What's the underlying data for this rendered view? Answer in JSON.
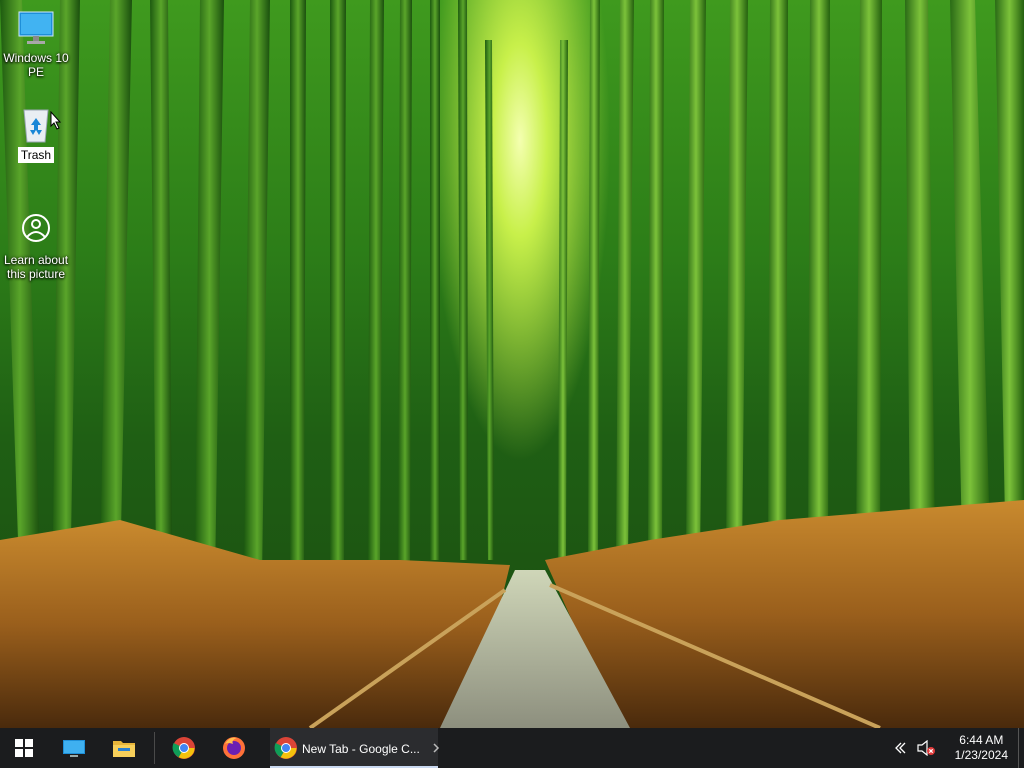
{
  "desktop": {
    "icons": [
      {
        "label": "Windows 10 PE",
        "icon": "monitor-icon"
      },
      {
        "label": "Trash",
        "icon": "recycle-bin-icon"
      },
      {
        "label": "Learn about this picture",
        "icon": "info-icon"
      }
    ]
  },
  "taskbar": {
    "start": {
      "icon": "windows-start-icon"
    },
    "pinned": [
      {
        "icon": "desktop-icon"
      },
      {
        "icon": "file-explorer-icon"
      },
      {
        "icon": "chrome-icon"
      },
      {
        "icon": "firefox-icon"
      }
    ],
    "active_app": {
      "title": "New Tab - Google C...",
      "icon": "chrome-icon"
    },
    "tray": {
      "overflow_icon": "chevron-left-icon",
      "volume_icon": "volume-muted-icon",
      "time": "6:44 AM",
      "date": "1/23/2024"
    }
  },
  "colors": {
    "taskbar_bg": "#1b1c1e",
    "active_app_bg": "#2b2c2f",
    "active_underline": "#c9d8f0"
  }
}
